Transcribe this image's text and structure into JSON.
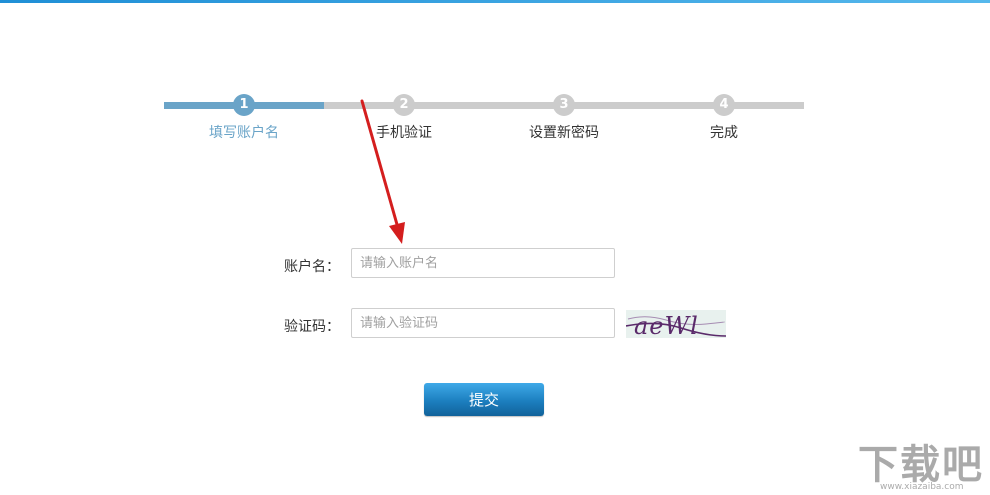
{
  "steps": [
    {
      "number": "1",
      "label": "填写账户名",
      "active": true
    },
    {
      "number": "2",
      "label": "手机验证",
      "active": false
    },
    {
      "number": "3",
      "label": "设置新密码",
      "active": false
    },
    {
      "number": "4",
      "label": "完成",
      "active": false
    }
  ],
  "form": {
    "account_label": "账户名：",
    "account_placeholder": "请输入账户名",
    "account_value": "",
    "captcha_label": "验证码：",
    "captcha_placeholder": "请输入验证码",
    "captcha_value": "",
    "captcha_text": "aeWl",
    "submit_label": "提交"
  },
  "watermark": {
    "text": "下载吧",
    "url": "www.xiazaiba.com"
  },
  "colors": {
    "active_step": "#6aa4c8",
    "inactive_step": "#cccccc",
    "button": "#1c7fbf",
    "annotation_arrow": "#d41e1e",
    "captcha_ink": "#5a2a6a"
  }
}
